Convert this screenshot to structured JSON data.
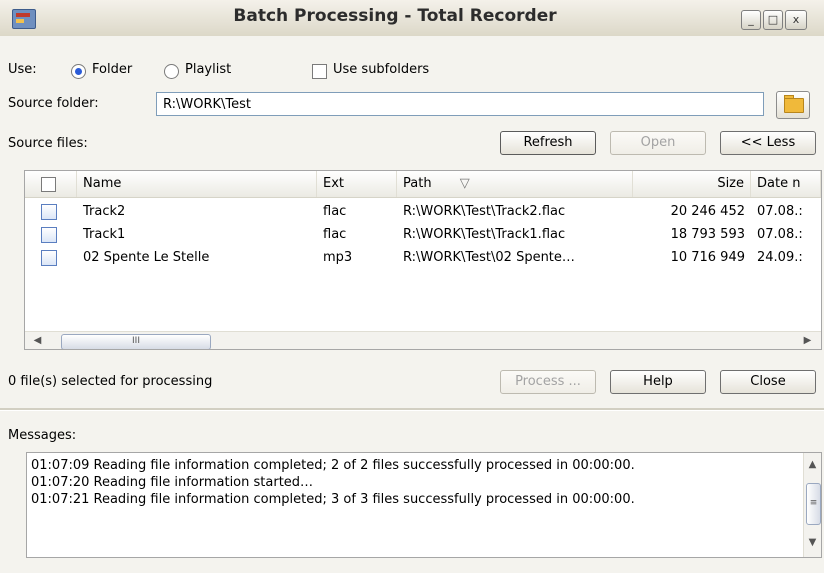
{
  "window": {
    "title": "Batch Processing - Total Recorder",
    "controls": {
      "minimize": "_",
      "maximize": "□",
      "close": "x"
    }
  },
  "use": {
    "label": "Use:",
    "options": [
      {
        "label": "Folder",
        "selected": true
      },
      {
        "label": "Playlist",
        "selected": false
      }
    ],
    "subfolders_label": "Use subfolders",
    "subfolders_checked": false
  },
  "source_folder": {
    "label": "Source folder:",
    "value": "R:\\WORK\\Test"
  },
  "source_files": {
    "label": "Source files:",
    "buttons": {
      "refresh": "Refresh",
      "open": "Open",
      "less": "<< Less"
    }
  },
  "file_list": {
    "columns": [
      "Name",
      "Ext",
      "Path",
      "Size",
      "Date n"
    ],
    "sort_indicator": "▽",
    "rows": [
      {
        "name": "Track2",
        "ext": "flac",
        "path": "R:\\WORK\\Test\\Track2.flac",
        "size": "20 246 452",
        "date": "07.08.:"
      },
      {
        "name": "Track1",
        "ext": "flac",
        "path": "R:\\WORK\\Test\\Track1.flac",
        "size": "18 793 593",
        "date": "07.08.:"
      },
      {
        "name": "02 Spente Le Stelle",
        "ext": "mp3",
        "path": "R:\\WORK\\Test\\02 Spente…",
        "size": "10 716 949",
        "date": "24.09.:"
      }
    ],
    "scroll_thumb_glyph": "III"
  },
  "status": {
    "selected_text": "0 file(s) selected for processing",
    "buttons": {
      "process": "Process ...",
      "help": "Help",
      "close": "Close"
    }
  },
  "messages": {
    "label": "Messages:",
    "lines": [
      "01:07:09 Reading file information completed; 2 of 2 files  successfully processed in 00:00:00.",
      "01:07:20 Reading file information started…",
      "01:07:21 Reading file information completed; 3 of 3 files  successfully processed in 00:00:00."
    ],
    "scroll_thumb_glyph": "≡"
  }
}
